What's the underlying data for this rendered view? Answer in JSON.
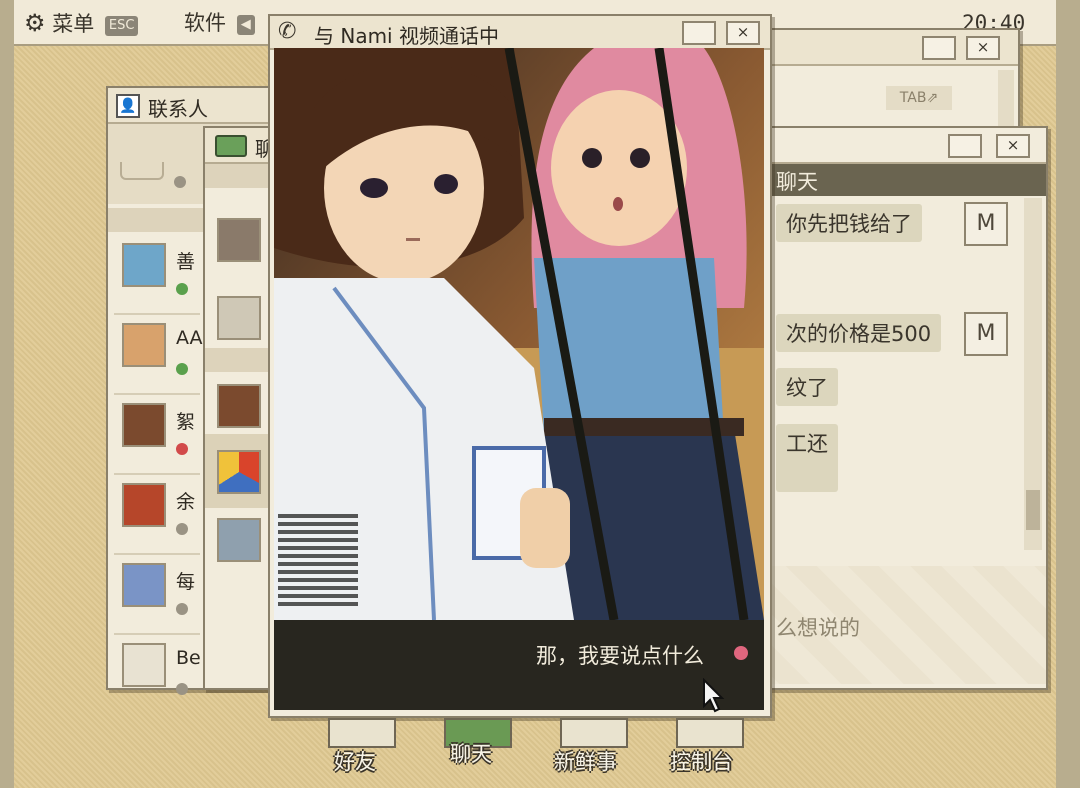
{
  "topbar": {
    "menu_label": "菜单",
    "menu_key": "ESC",
    "software_label": "软件",
    "clock": "20:40"
  },
  "contacts_window": {
    "title": "联系人",
    "contacts": [
      {
        "name": "善",
        "status_color": "#5aa04c"
      },
      {
        "name": "AA",
        "status_color": "#5aa04c"
      },
      {
        "name": "絮",
        "status_color": "#d24a4a"
      },
      {
        "name": "余",
        "status_color": "#9a9384"
      },
      {
        "name": "每",
        "status_color": "#9a9384"
      },
      {
        "name": "Be",
        "status_color": "#9a9384"
      }
    ]
  },
  "chat_list_window": {
    "title": "聊"
  },
  "right_back_window": {
    "tab_label": "TAB"
  },
  "chat_window": {
    "title": "聊天",
    "messages": [
      "你先把钱给了",
      "次的价格是500",
      "纹了",
      "工还"
    ],
    "input_placeholder": "么想说的"
  },
  "video_call": {
    "title": "与 Nami 视频通话中",
    "close_label": "×",
    "subtitle": "那，我要说点什么"
  },
  "dock": {
    "items": [
      {
        "label": "好友"
      },
      {
        "label": "聊天"
      },
      {
        "label": "新鲜事"
      },
      {
        "label": "控制台"
      }
    ]
  }
}
